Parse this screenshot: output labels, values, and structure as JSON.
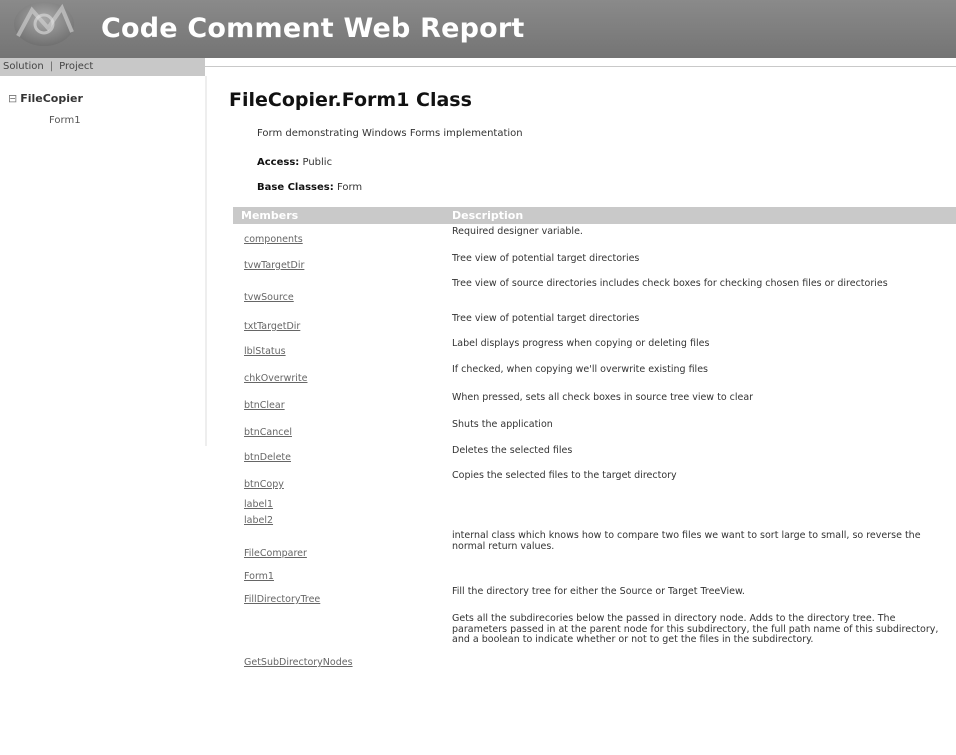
{
  "header": {
    "title": "Code Comment Web Report",
    "logo_icon": "gear-logo-icon"
  },
  "nav": {
    "solution_link": "Solution",
    "separator": "|",
    "project_link": "Project"
  },
  "tree": {
    "expander_icon": "tree-collapse-icon",
    "expander_glyph": "⊟",
    "root": "FileCopier",
    "children": [
      "Form1"
    ]
  },
  "class": {
    "title": "FileCopier.Form1 Class",
    "summary": "Form demonstrating Windows Forms implementation",
    "access_label": "Access:",
    "access_value": "Public",
    "base_label": "Base Classes:",
    "base_value": "Form"
  },
  "members": {
    "headers": [
      "Members",
      "Description"
    ],
    "rows": [
      {
        "name": "components",
        "description": "Required designer variable."
      },
      {
        "name": "tvwTargetDir",
        "description": "Tree view of potential target directories"
      },
      {
        "name": "tvwSource",
        "description": "Tree view of source directories includes check boxes for checking chosen files or directories"
      },
      {
        "name": "txtTargetDir",
        "description": "Tree view of potential target directories"
      },
      {
        "name": "lblStatus",
        "description": "Label displays progress when copying or deleting files"
      },
      {
        "name": "chkOverwrite",
        "description": "If checked, when copying we'll overwrite existing files"
      },
      {
        "name": "btnClear",
        "description": "When pressed, sets all check boxes in source tree view to clear"
      },
      {
        "name": "btnCancel",
        "description": "Shuts the application"
      },
      {
        "name": "btnDelete",
        "description": "Deletes the selected files"
      },
      {
        "name": "btnCopy",
        "description": "Copies the selected files to the target directory"
      },
      {
        "name": "label1",
        "description": ""
      },
      {
        "name": "label2",
        "description": ""
      },
      {
        "name": "FileComparer",
        "description": "internal class which knows how to compare two files we want to sort large to small, so reverse the normal return values."
      },
      {
        "name": "Form1",
        "description": ""
      },
      {
        "name": "FillDirectoryTree",
        "description": "Fill the directory tree for either the Source or Target TreeView."
      },
      {
        "name": "GetSubDirectoryNodes",
        "description": "Gets all the subdirecories below the passed in directory node. Adds to the directory tree. The parameters passed in at the parent node for this subdirectory, the full path name of this subdirectory, and a boolean to indicate whether or not to get the files in the subdirectory."
      }
    ]
  }
}
